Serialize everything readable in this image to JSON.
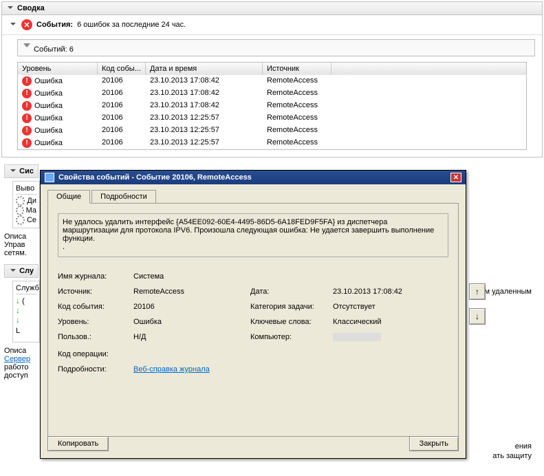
{
  "summary": {
    "title": "Сводка"
  },
  "events_bar": {
    "label": "События:",
    "text": "6 ошибок за последние 24 час."
  },
  "events_count": {
    "prefix": "Событий:",
    "n": "6"
  },
  "grid": {
    "headers": {
      "level": "Уровень",
      "code": "Код собы...",
      "date": "Дата и время",
      "source": "Источник"
    },
    "rows": [
      {
        "level": "Ошибка",
        "code": "20106",
        "date": "23.10.2013 17:08:42",
        "source": "RemoteAccess"
      },
      {
        "level": "Ошибка",
        "code": "20106",
        "date": "23.10.2013 17:08:42",
        "source": "RemoteAccess"
      },
      {
        "level": "Ошибка",
        "code": "20106",
        "date": "23.10.2013 17:08:42",
        "source": "RemoteAccess"
      },
      {
        "level": "Ошибка",
        "code": "20106",
        "date": "23.10.2013 12:25:57",
        "source": "RemoteAccess"
      },
      {
        "level": "Ошибка",
        "code": "20106",
        "date": "23.10.2013 12:25:57",
        "source": "RemoteAccess"
      },
      {
        "level": "Ошибка",
        "code": "20106",
        "date": "23.10.2013 12:25:57",
        "source": "RemoteAccess"
      }
    ]
  },
  "sections": {
    "sis": "Сис",
    "vyvo": "Выво",
    "di": "Ди",
    "ma": "Ма",
    "se": "Се",
    "opisa": "Описа",
    "uprav": "Управ",
    "setyam": "сетям.",
    "slu": "Слу",
    "sluzhb": "Служб",
    "l1": "(",
    "l2": "L",
    "opisa2": "Описа",
    "server": "Сервер",
    "raboto": "работо",
    "dostupa": "доступ",
    "rem1": "им удаленным",
    "rem2": "ения",
    "rem3": "ать защиту"
  },
  "dialog": {
    "title": "Свойства событий - Событие 20106, RemoteAccess",
    "tabs": {
      "general": "Общие",
      "details": "Подробности"
    },
    "message": "Не удалось удалить интерфейс {A54EE092-60E4-4495-86D5-6A18FED9F5FA} из диспетчера маршрутизации для протокола IPV6. Произошла следующая ошибка: Не удается завершить выполнение функции.\n.",
    "fields": {
      "log_name_l": "Имя журнала:",
      "log_name_v": "Система",
      "source_l": "Источник:",
      "source_v": "RemoteAccess",
      "date_l": "Дата:",
      "date_v": "23.10.2013 17:08:42",
      "code_l": "Код события:",
      "code_v": "20106",
      "taskcat_l": "Категория задачи:",
      "taskcat_v": "Отсутствует",
      "level_l": "Уровень:",
      "level_v": "Ошибка",
      "keywords_l": "Ключевые слова:",
      "keywords_v": "Классический",
      "user_l": "Пользов.:",
      "user_v": "Н/Д",
      "computer_l": "Компьютер:",
      "opcode_l": "Код операции:",
      "details_l": "Подробности:",
      "details_link": "Веб-справка журнала"
    },
    "buttons": {
      "copy": "Копировать",
      "close": "Закрыть",
      "up": "↑",
      "down": "↓"
    }
  }
}
